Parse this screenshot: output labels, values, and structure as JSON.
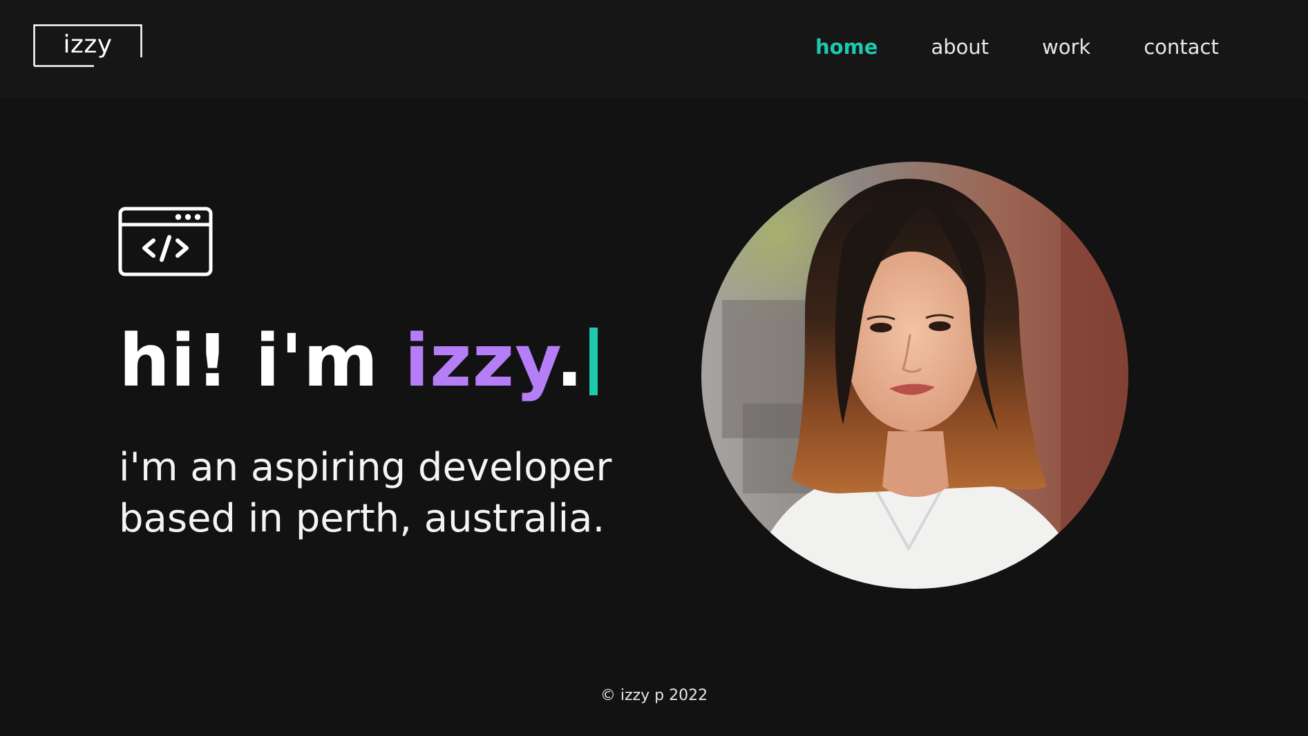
{
  "brand": {
    "logo_text": "izzy"
  },
  "nav": {
    "items": [
      {
        "label": "home",
        "active": true
      },
      {
        "label": "about",
        "active": false
      },
      {
        "label": "work",
        "active": false
      },
      {
        "label": "contact",
        "active": false
      }
    ]
  },
  "hero": {
    "icon": "code-window-icon",
    "headline_prefix": "hi! i'm ",
    "headline_name": "izzy",
    "headline_suffix": ".",
    "tagline_line1": "i'm an aspiring developer",
    "tagline_line2": "based in perth, australia."
  },
  "portrait": {
    "icon": "profile-photo"
  },
  "footer": {
    "copyright": "© izzy p 2022"
  },
  "colors": {
    "background": "#121212",
    "header_background": "#161616",
    "accent_teal": "#1ec9ad",
    "accent_purple": "#b57ef7",
    "text": "#ffffff"
  }
}
